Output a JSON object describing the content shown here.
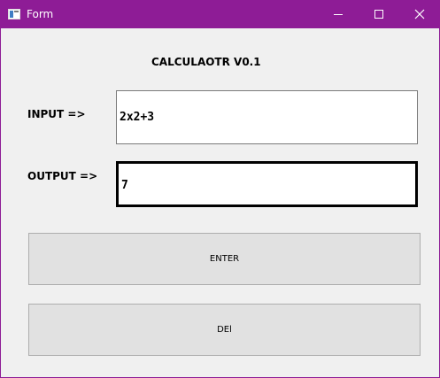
{
  "window": {
    "title": "Form",
    "icon": "app-window-icon",
    "accent_color": "#8e1c96"
  },
  "heading": "CALCULAOTR V0.1",
  "input": {
    "label": "INPUT =>",
    "value": "2x2+3"
  },
  "output": {
    "label": "OUTPUT =>",
    "value": "7"
  },
  "buttons": {
    "enter_label": "ENTER",
    "del_label": "DEl"
  }
}
